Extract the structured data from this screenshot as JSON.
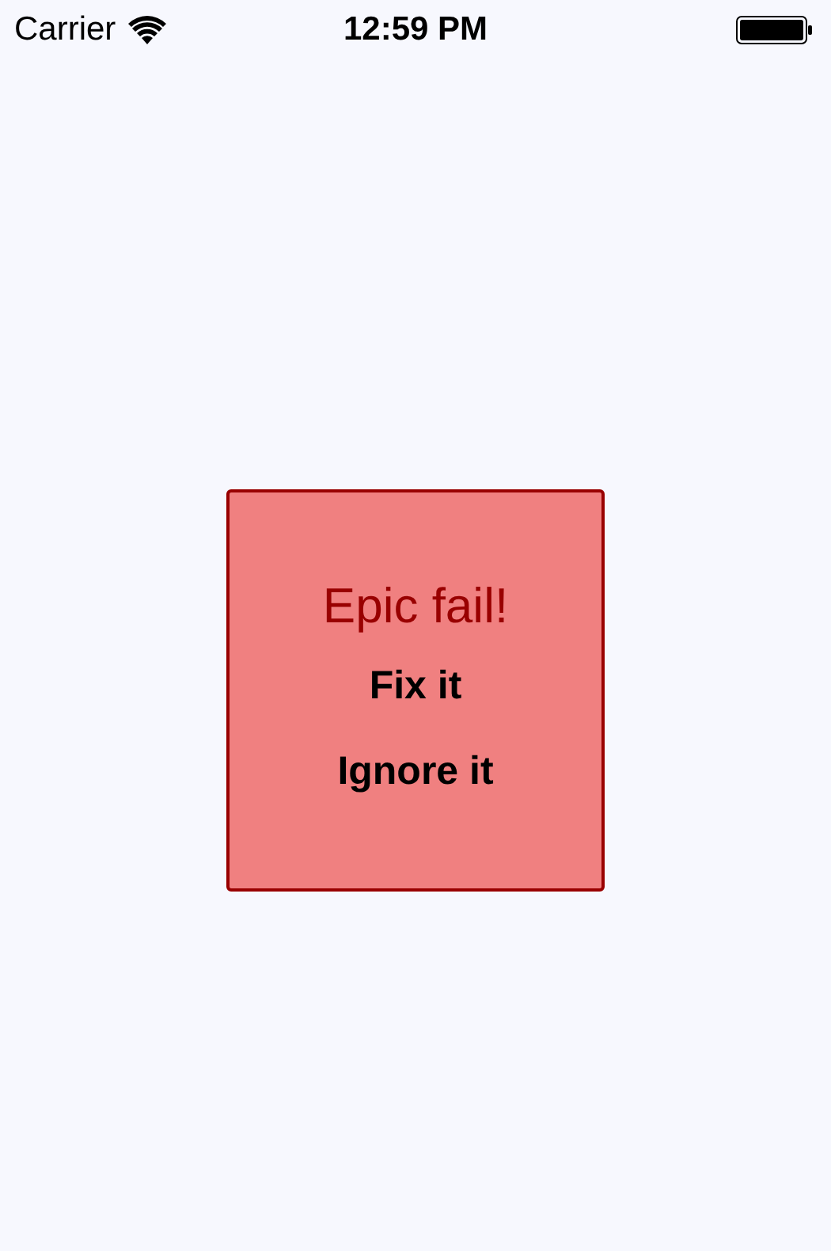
{
  "status_bar": {
    "carrier": "Carrier",
    "time": "12:59 PM"
  },
  "alert": {
    "title": "Epic fail!",
    "buttons": [
      "Fix it",
      "Ignore it"
    ]
  }
}
